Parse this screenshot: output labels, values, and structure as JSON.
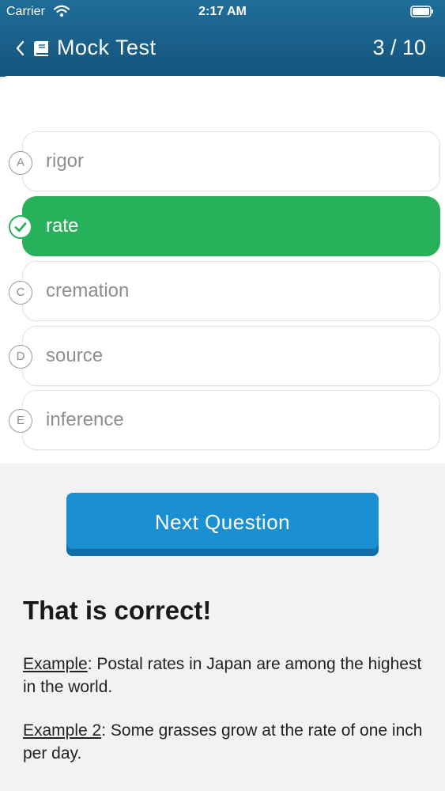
{
  "status_bar": {
    "carrier": "Carrier",
    "time": "2:17 AM"
  },
  "nav": {
    "title": "Mock Test",
    "counter": "3 / 10"
  },
  "options": [
    {
      "letter": "A",
      "text": "rigor",
      "state": "normal"
    },
    {
      "letter": "",
      "text": "rate",
      "state": "correct"
    },
    {
      "letter": "C",
      "text": "cremation",
      "state": "normal"
    },
    {
      "letter": "D",
      "text": "source",
      "state": "normal"
    },
    {
      "letter": "E",
      "text": "inference",
      "state": "normal"
    }
  ],
  "next_button": {
    "label": "Next Question"
  },
  "feedback": {
    "title": "That is correct!",
    "example1_label": "Example",
    "example1_text": ": Postal rates in Japan are among the highest in the world.",
    "example2_label": "Example 2",
    "example2_text": ": Some grasses grow at the rate of one inch per day."
  },
  "colors": {
    "header": "#1a6390",
    "correct": "#27b15a",
    "button": "#1a8fd1"
  }
}
